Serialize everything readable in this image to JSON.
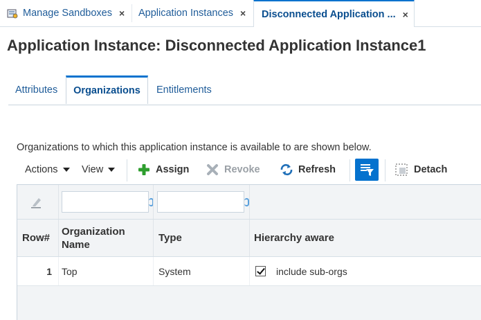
{
  "tabs": [
    {
      "label": "Manage Sandboxes",
      "icon": "sandbox-icon",
      "close": "×"
    },
    {
      "label": "Application Instances",
      "close": "×"
    },
    {
      "label": "Disconnected Application ...",
      "close": "×",
      "active": true
    }
  ],
  "page": {
    "title": "Application Instance: Disconnected Application Instance1"
  },
  "subtabs": [
    {
      "label": "Attributes"
    },
    {
      "label": "Organizations",
      "active": true
    },
    {
      "label": "Entitlements"
    }
  ],
  "description": "Organizations to which this application instance is available to are shown below.",
  "toolbar": {
    "actions_label": "Actions",
    "view_label": "View",
    "assign_label": "Assign",
    "revoke_label": "Revoke",
    "refresh_label": "Refresh",
    "detach_label": "Detach"
  },
  "table": {
    "filters": {
      "organization_name": "",
      "type": ""
    },
    "columns": [
      "Row#",
      "Organization Name",
      "Type",
      "Hierarchy aware"
    ],
    "rows": [
      {
        "row": "1",
        "organization_name": "Top",
        "type": "System",
        "hierarchy_checked": true,
        "hierarchy_label": "include sub-orgs"
      }
    ]
  },
  "colors": {
    "accent": "#0572ce",
    "link": "#1f5c99",
    "assign_icon": "#2e9e2e",
    "toolbar_filter_bg": "#0572ce"
  }
}
